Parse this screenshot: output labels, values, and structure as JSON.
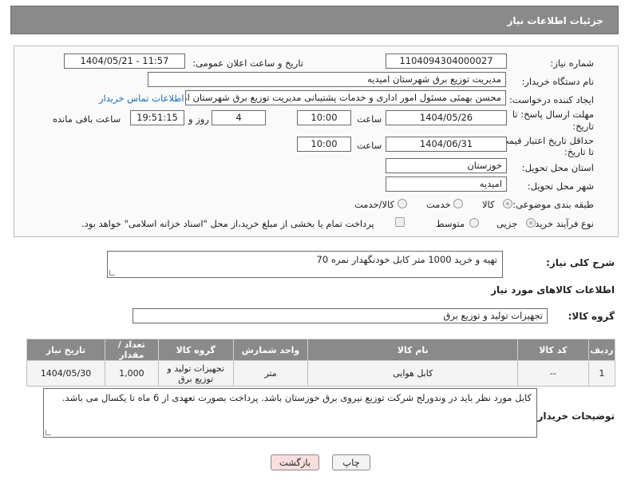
{
  "header": {
    "title": "جزئیات اطلاعات نیاز"
  },
  "form": {
    "need_number_label": "شماره نیاز:",
    "need_number": "1104094304000027",
    "announce_label": "تاریخ و ساعت اعلان عمومی:",
    "announce_value": "1404/05/21 - 11:57",
    "buyer_org_label": "نام دستگاه خریدار:",
    "buyer_org": "مدیریت توزیع برق شهرستان امیدیه",
    "creator_label": "ایجاد کننده درخواست:",
    "creator": "محسن بهمئی مسئول امور اداری و خدمات پشتیبانی مدیریت توزیع برق شهرستان امیدیه",
    "contact_link": "اطلاعات تماس خریدار",
    "deadline_label_1": "مهلت ارسال پاسخ: تا",
    "deadline_label_2": "تاریخ:",
    "deadline_date": "1404/05/26",
    "time_label": "ساعت",
    "deadline_time": "10:00",
    "days_value": "4",
    "days_label": "روز و",
    "remaining_time": "19:51:15",
    "remaining_label": "ساعت باقی مانده",
    "validity_label_1": "حداقل تاریخ اعتبار قیمت:",
    "validity_label_2": "تا تاریخ:",
    "validity_date": "1404/06/31",
    "validity_time": "10:00",
    "province_label": "استان محل تحویل:",
    "province": "خوزستان",
    "city_label": "شهر محل تحویل:",
    "city": "امیدیه",
    "category_label": "طبقه بندی موضوعی:",
    "category_options": [
      "کالا",
      "خدمت",
      "کالا/خدمت"
    ],
    "category_selected": "کالا",
    "process_label": "نوع فرآیند خرید :",
    "process_options": [
      "جزیی",
      "متوسط"
    ],
    "process_selected": "جزیی",
    "payment_note": "پرداخت تمام یا بخشی از مبلغ خرید،از محل \"اسناد خزانه اسلامی\" خواهد بود."
  },
  "summary": {
    "label": "شرح کلی نیاز:",
    "value": "تهیه و خرید 1000 متر کابل خودنگهدار نمره 70"
  },
  "goods": {
    "section_title": "اطلاعات کالاهای مورد نیاز",
    "group_label": "گروه کالا:",
    "group_value": "تجهیزات تولید و توزیع برق",
    "columns": [
      "ردیف",
      "کد کالا",
      "نام کالا",
      "واحد شمارش",
      "گروه کالا",
      "تعداد / مقدار",
      "تاریخ نیاز"
    ],
    "rows": [
      {
        "row": "1",
        "code": "--",
        "name": "کابل هوایی",
        "unit": "متر",
        "group": "تجهیزات تولید و توزیع برق",
        "qty": "1,000",
        "date": "1404/05/30"
      }
    ]
  },
  "buyer_notes": {
    "label": "توضیحات خریدار:",
    "value": "کابل مورد نظر باید در وندورلج شرکت توزیع نیروی برق خوزستان باشد. پرداخت بصورت تعهدی از 6 ماه تا یکسال می باشد."
  },
  "buttons": {
    "print": "چاپ",
    "back": "بازگشت"
  },
  "colors": {
    "header_bg": "#8a8a8a",
    "link": "#1b6fb5",
    "back_btn_bg": "#f9dede"
  }
}
